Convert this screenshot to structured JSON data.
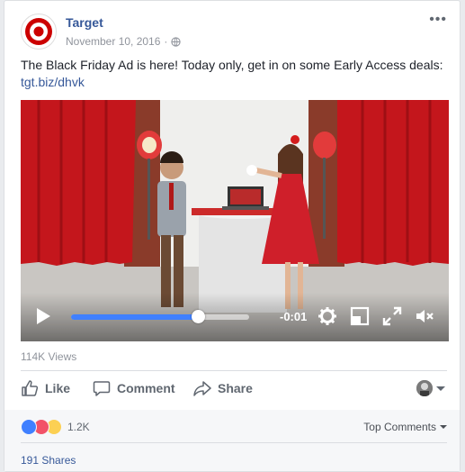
{
  "post": {
    "page_name": "Target",
    "date": "November 10, 2016",
    "separator": "·",
    "text": "The Black Friday Ad is here! Today only, get in on some Early Access deals:",
    "link": "tgt.biz/dhvk",
    "more_icon": "more-horizontal-icon",
    "privacy_icon": "globe-icon"
  },
  "video": {
    "time_label": "-0:01",
    "progress": 0.71,
    "controls": [
      "play-icon",
      "settings-gear-icon",
      "theater-mode-icon",
      "fullscreen-icon",
      "mute-icon"
    ]
  },
  "stats": {
    "views": "114K Views",
    "reaction_count": "1.2K",
    "reactions": [
      "like",
      "love",
      "wow"
    ],
    "shares": "191 Shares",
    "top_comments": "Top Comments"
  },
  "actions": {
    "like": "Like",
    "comment": "Comment",
    "share": "Share"
  },
  "colors": {
    "link": "#365899",
    "progress": "#4080ff",
    "target_red": "#cc0000"
  }
}
